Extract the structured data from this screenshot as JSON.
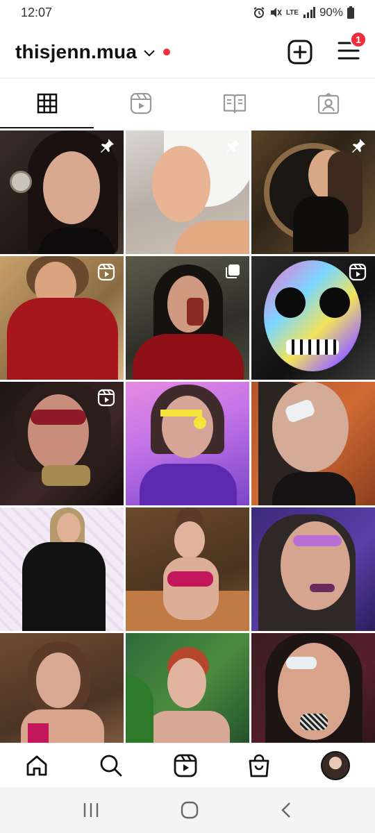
{
  "status_bar": {
    "time": "12:07",
    "network": "LTE",
    "battery": "90%"
  },
  "header": {
    "username": "thisjenn.mua",
    "notification_count": "1"
  },
  "tabs": [
    {
      "name": "posts-grid",
      "icon": "grid-icon",
      "active": true
    },
    {
      "name": "reels",
      "icon": "reels-icon",
      "active": false
    },
    {
      "name": "guides",
      "icon": "guide-icon",
      "active": false
    },
    {
      "name": "tagged",
      "icon": "tagged-icon",
      "active": false
    }
  ],
  "posts": [
    {
      "overlay": "pin-icon"
    },
    {
      "overlay": "pin-icon"
    },
    {
      "overlay": "pin-icon"
    },
    {
      "overlay": "reel-icon"
    },
    {
      "overlay": "carousel-icon"
    },
    {
      "overlay": "reel-icon"
    },
    {
      "overlay": "reel-icon"
    },
    {
      "overlay": ""
    },
    {
      "overlay": ""
    },
    {
      "overlay": ""
    },
    {
      "overlay": ""
    },
    {
      "overlay": ""
    },
    {
      "overlay": ""
    },
    {
      "overlay": ""
    },
    {
      "overlay": ""
    }
  ],
  "bottom_nav": [
    "home-icon",
    "search-icon",
    "reels-icon",
    "shop-icon",
    "profile-avatar"
  ],
  "colors": {
    "notification": "#ed2f3d",
    "text": "#111111"
  }
}
